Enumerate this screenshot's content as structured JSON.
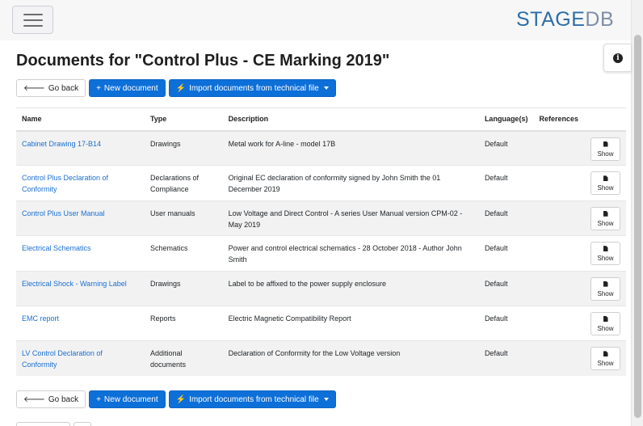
{
  "header": {
    "logo_primary": "STAGE",
    "logo_secondary": "DB",
    "menu_icon": "hamburger-icon"
  },
  "page": {
    "title": "Documents for \"Control Plus - CE Marking 2019\""
  },
  "info": {
    "icon": "info-icon",
    "glyph": "i"
  },
  "actions": {
    "back_label": "Go back",
    "new_label": "New document",
    "import_label": "Import documents from technical file"
  },
  "table": {
    "columns": [
      "Name",
      "Type",
      "Description",
      "Language(s)",
      "References",
      ""
    ],
    "show_label": "Show",
    "rows": [
      {
        "name": "Cabinet Drawing 17-B14",
        "type": "Drawings",
        "description": "Metal work for A-line - model 17B",
        "language": "Default",
        "references": ""
      },
      {
        "name": "Control Plus Declaration of Conformity",
        "type": "Declarations of Compliance",
        "description": "Original EC declaration of conformity signed by John Smith the 01 December 2019",
        "language": "Default",
        "references": ""
      },
      {
        "name": "Control Plus User Manual",
        "type": "User manuals",
        "description": "Low Voltage and Direct Control - A series User Manual version CPM-02 - May 2019",
        "language": "Default",
        "references": ""
      },
      {
        "name": "Electrical Schematics",
        "type": "Schematics",
        "description": "Power and control electrical schematics - 28 October 2018 - Author John Smith",
        "language": "Default",
        "references": ""
      },
      {
        "name": "Electrical Shock - Warning Label",
        "type": "Drawings",
        "description": "Label to be affixed to the power supply enclosure",
        "language": "Default",
        "references": ""
      },
      {
        "name": "EMC report",
        "type": "Reports",
        "description": "Electric Magnetic Compatibility Report",
        "language": "Default",
        "references": ""
      },
      {
        "name": "LV Control Declaration of Conformity",
        "type": "Additional documents",
        "description": "Declaration of Conformity for the Low Voltage version",
        "language": "Default",
        "references": ""
      }
    ]
  }
}
